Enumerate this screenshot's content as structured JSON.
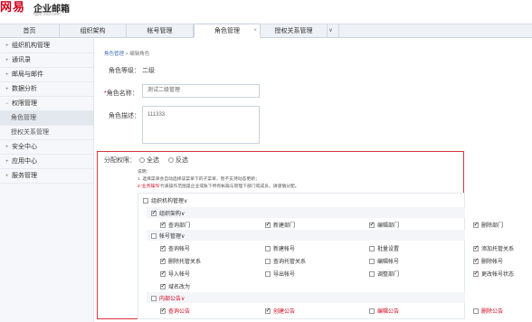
{
  "header": {
    "logo_mark": "网易",
    "title": "企业邮箱",
    "url": "qiye.163.com"
  },
  "topnav": {
    "tabs": [
      {
        "label": "首页"
      },
      {
        "label": "组织架构"
      },
      {
        "label": "帐号管理"
      },
      {
        "label": "角色管理",
        "active": true
      },
      {
        "label": "授权关系管理"
      }
    ],
    "close_glyph": "×",
    "more_glyph": "∨"
  },
  "sidebar": {
    "items": [
      {
        "label": "组织机构管理",
        "arrow": "+"
      },
      {
        "label": "通讯录",
        "arrow": "+"
      },
      {
        "label": "邮局与邮件",
        "arrow": "+"
      },
      {
        "label": "数据分析",
        "arrow": "+"
      },
      {
        "label": "权限管理",
        "arrow": "−"
      },
      {
        "label": "角色管理",
        "sub": true,
        "active": true
      },
      {
        "label": "授权关系管理",
        "sub": true
      },
      {
        "label": "安全中心",
        "arrow": "+"
      },
      {
        "label": "应用中心",
        "arrow": "+"
      },
      {
        "label": "服务管理",
        "arrow": "+"
      }
    ]
  },
  "main": {
    "breadcrumb": {
      "link": "角色管理",
      "sep": " > ",
      "current": "编辑角色"
    },
    "level_label": "角色等级：",
    "level_value": "二级",
    "name_label": "角色名称：",
    "name_required": "*",
    "name_value": "测试二级管理",
    "desc_label": "角色描述：",
    "desc_value": "111333",
    "perm": {
      "label": "分配权限：",
      "select_all": "全选",
      "invert": "反选",
      "note_title": "说明：",
      "note_1": "1. 选择菜单会自动选择该菜单下的子菜单，暂不支持动态更新；",
      "note_2_red": "2.'业务操作'",
      "note_2_rest": "代表操作范围是企业或账下所有帐篇与管理下部门或成员，请谨慎分配。",
      "tree": {
        "root": "组织机构管理∨",
        "g1": "组织架构∨",
        "g1_items": [
          "查询部门",
          "新建部门",
          "编辑部门",
          "删除部门"
        ],
        "g2": "帐号管理∨",
        "g2_rows": [
          [
            "查询帐号",
            "新建帐号",
            "批量设置",
            "添加托管关系"
          ],
          [
            "删除托管关系",
            "查询托管关系",
            "编辑帐号",
            "删除帐号"
          ],
          [
            "导入帐号",
            "导出帐号",
            "调整部门",
            "更改帐号状态"
          ],
          [
            "域名改为"
          ]
        ],
        "g3": "内部公告∨",
        "g3_items": [
          "查询公告",
          "创建公告",
          "编辑公告",
          "删除公告"
        ]
      }
    }
  }
}
